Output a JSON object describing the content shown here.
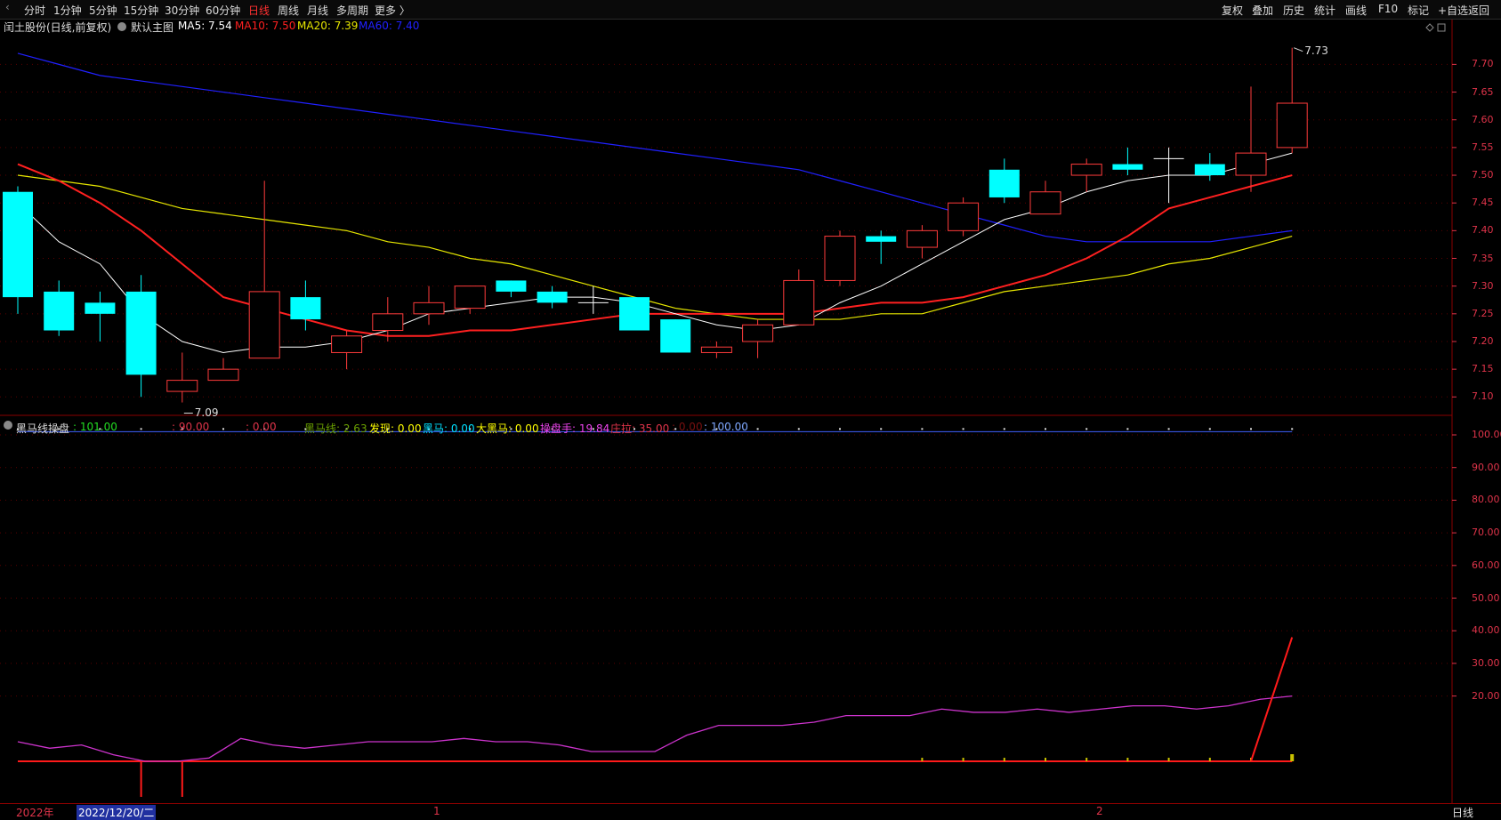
{
  "toolbar": {
    "left": [
      "分时",
      "1分钟",
      "5分钟",
      "15分钟",
      "30分钟",
      "60分钟",
      "日线",
      "周线",
      "月线",
      "多周期",
      "更多 〉"
    ],
    "active": "日线",
    "right": [
      "复权",
      "叠加",
      "历史",
      "统计",
      "画线",
      "F10",
      "标记",
      "+自选",
      "返回"
    ]
  },
  "main_legend": {
    "title": "闰土股份(日线,前复权)",
    "indicator_name": "默认主图",
    "ma5": "MA5: 7.54",
    "ma10": "MA10: 7.50",
    "ma20": "MA20: 7.39",
    "ma60": "MA60: 7.40"
  },
  "sub_legend": {
    "name": "黑马线操盘",
    "v1": ": 101.00",
    "v2": ": 90.00",
    "v3": ": 0.00",
    "heimaxian": "黑马线: 2.63",
    "faxian": "发现: 0.00",
    "heima": "黑马: 0.00",
    "daheima": "大黑马: 0.00",
    "caopanshou": "操盘手: 19.84",
    "zhuangla": "庄拉: 35.00",
    "v9": ": 0.00",
    "v10": ": 100.00"
  },
  "annotations": {
    "high": "7.73",
    "low": "7.09"
  },
  "status": {
    "year": "2022年",
    "date": "2022/12/20/二",
    "month1": "1",
    "month2": "2",
    "period": "日线"
  },
  "colors": {
    "up": "#ff3b3b",
    "down": "#00ffff",
    "ma5": "#ffffff",
    "ma10": "#ff2020",
    "ma20": "#e6e600",
    "ma60": "#2020ff",
    "axis": "#e0344a",
    "sub_line": "#cc33cc",
    "horse": "#ff1a1a"
  },
  "chart_data": {
    "type": "candlestick",
    "ylim": [
      7.07,
      7.76
    ],
    "y_ticks": [
      7.1,
      7.15,
      7.2,
      7.25,
      7.3,
      7.35,
      7.4,
      7.45,
      7.5,
      7.55,
      7.6,
      7.65,
      7.7
    ],
    "candles": [
      {
        "o": 7.47,
        "h": 7.48,
        "l": 7.25,
        "c": 7.28
      },
      {
        "o": 7.29,
        "h": 7.31,
        "l": 7.21,
        "c": 7.22
      },
      {
        "o": 7.27,
        "h": 7.29,
        "l": 7.2,
        "c": 7.25
      },
      {
        "o": 7.29,
        "h": 7.32,
        "l": 7.1,
        "c": 7.14
      },
      {
        "o": 7.11,
        "h": 7.18,
        "l": 7.09,
        "c": 7.13
      },
      {
        "o": 7.13,
        "h": 7.17,
        "l": 7.13,
        "c": 7.15
      },
      {
        "o": 7.17,
        "h": 7.49,
        "l": 7.17,
        "c": 7.29
      },
      {
        "o": 7.28,
        "h": 7.31,
        "l": 7.22,
        "c": 7.24
      },
      {
        "o": 7.18,
        "h": 7.22,
        "l": 7.15,
        "c": 7.21
      },
      {
        "o": 7.22,
        "h": 7.28,
        "l": 7.2,
        "c": 7.25
      },
      {
        "o": 7.25,
        "h": 7.3,
        "l": 7.23,
        "c": 7.27
      },
      {
        "o": 7.26,
        "h": 7.3,
        "l": 7.25,
        "c": 7.3
      },
      {
        "o": 7.31,
        "h": 7.31,
        "l": 7.28,
        "c": 7.29
      },
      {
        "o": 7.29,
        "h": 7.3,
        "l": 7.26,
        "c": 7.27
      },
      {
        "o": 7.27,
        "h": 7.3,
        "l": 7.25,
        "c": 7.27
      },
      {
        "o": 7.28,
        "h": 7.28,
        "l": 7.22,
        "c": 7.22
      },
      {
        "o": 7.24,
        "h": 7.24,
        "l": 7.18,
        "c": 7.18
      },
      {
        "o": 7.18,
        "h": 7.2,
        "l": 7.17,
        "c": 7.19
      },
      {
        "o": 7.2,
        "h": 7.24,
        "l": 7.17,
        "c": 7.23
      },
      {
        "o": 7.23,
        "h": 7.33,
        "l": 7.23,
        "c": 7.31
      },
      {
        "o": 7.31,
        "h": 7.4,
        "l": 7.3,
        "c": 7.39
      },
      {
        "o": 7.39,
        "h": 7.4,
        "l": 7.34,
        "c": 7.38
      },
      {
        "o": 7.37,
        "h": 7.41,
        "l": 7.35,
        "c": 7.4
      },
      {
        "o": 7.4,
        "h": 7.46,
        "l": 7.39,
        "c": 7.45
      },
      {
        "o": 7.51,
        "h": 7.53,
        "l": 7.45,
        "c": 7.46
      },
      {
        "o": 7.43,
        "h": 7.49,
        "l": 7.43,
        "c": 7.47
      },
      {
        "o": 7.5,
        "h": 7.53,
        "l": 7.47,
        "c": 7.52
      },
      {
        "o": 7.52,
        "h": 7.55,
        "l": 7.5,
        "c": 7.51
      },
      {
        "o": 7.53,
        "h": 7.55,
        "l": 7.45,
        "c": 7.53
      },
      {
        "o": 7.52,
        "h": 7.54,
        "l": 7.49,
        "c": 7.5
      },
      {
        "o": 7.5,
        "h": 7.66,
        "l": 7.47,
        "c": 7.54
      },
      {
        "o": 7.55,
        "h": 7.73,
        "l": 7.54,
        "c": 7.63
      }
    ],
    "ma5": [
      7.45,
      7.38,
      7.34,
      7.25,
      7.2,
      7.18,
      7.19,
      7.19,
      7.2,
      7.22,
      7.25,
      7.26,
      7.27,
      7.28,
      7.28,
      7.27,
      7.25,
      7.23,
      7.22,
      7.23,
      7.27,
      7.3,
      7.34,
      7.38,
      7.42,
      7.44,
      7.47,
      7.49,
      7.5,
      7.5,
      7.52,
      7.54
    ],
    "ma10": [
      7.52,
      7.49,
      7.45,
      7.4,
      7.34,
      7.28,
      7.26,
      7.24,
      7.22,
      7.21,
      7.21,
      7.22,
      7.22,
      7.23,
      7.24,
      7.25,
      7.25,
      7.25,
      7.25,
      7.25,
      7.26,
      7.27,
      7.27,
      7.28,
      7.3,
      7.32,
      7.35,
      7.39,
      7.44,
      7.46,
      7.48,
      7.5
    ],
    "ma20": [
      7.5,
      7.49,
      7.48,
      7.46,
      7.44,
      7.43,
      7.42,
      7.41,
      7.4,
      7.38,
      7.37,
      7.35,
      7.34,
      7.32,
      7.3,
      7.28,
      7.26,
      7.25,
      7.24,
      7.24,
      7.24,
      7.25,
      7.25,
      7.27,
      7.29,
      7.3,
      7.31,
      7.32,
      7.34,
      7.35,
      7.37,
      7.39
    ],
    "ma60": [
      7.72,
      7.7,
      7.68,
      7.67,
      7.66,
      7.65,
      7.64,
      7.63,
      7.62,
      7.61,
      7.6,
      7.59,
      7.58,
      7.57,
      7.56,
      7.55,
      7.54,
      7.53,
      7.52,
      7.51,
      7.49,
      7.47,
      7.45,
      7.43,
      7.41,
      7.39,
      7.38,
      7.38,
      7.38,
      7.38,
      7.39,
      7.4
    ],
    "sub_ylim": [
      0,
      103
    ],
    "sub_ticks": [
      20,
      30,
      40,
      50,
      60,
      70,
      80,
      90,
      100
    ],
    "ref_line": 101,
    "caopanshou": [
      6,
      4,
      5,
      2,
      0,
      0,
      1,
      7,
      5,
      4,
      5,
      6,
      6,
      6,
      7,
      6,
      6,
      5,
      3,
      3,
      3,
      8,
      11,
      11,
      11,
      12,
      14,
      14,
      14,
      16,
      15,
      15,
      16,
      15,
      16,
      17,
      17,
      16,
      17,
      19,
      20
    ],
    "zhuangla_spike": [
      38,
      35
    ],
    "negative_bars": [
      3,
      4
    ],
    "small_bars": [
      22,
      23,
      24,
      25,
      26,
      27,
      28,
      29,
      30,
      31
    ]
  }
}
